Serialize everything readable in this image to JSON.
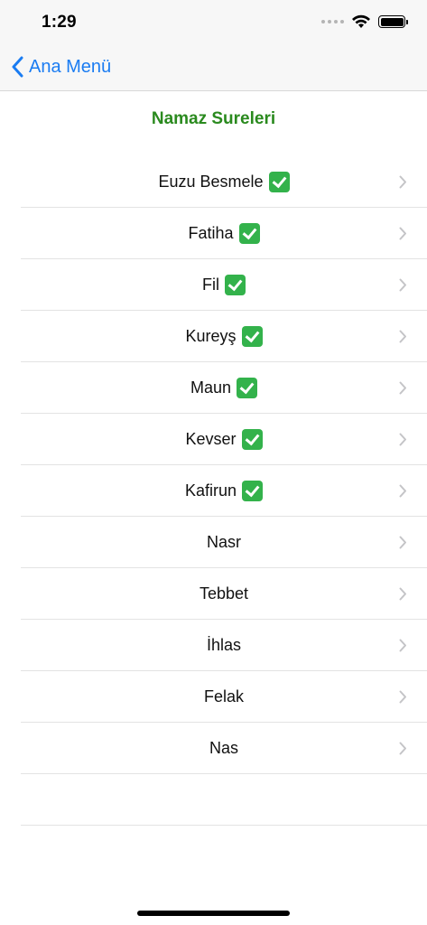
{
  "status": {
    "time": "1:29"
  },
  "nav": {
    "back_label": "Ana Menü"
  },
  "page": {
    "title": "Namaz Sureleri"
  },
  "list": {
    "items": [
      {
        "label": "Euzu Besmele",
        "checked": true
      },
      {
        "label": "Fatiha",
        "checked": true
      },
      {
        "label": "Fil",
        "checked": true
      },
      {
        "label": "Kureyş",
        "checked": true
      },
      {
        "label": "Maun",
        "checked": true
      },
      {
        "label": "Kevser",
        "checked": true
      },
      {
        "label": "Kafirun",
        "checked": true
      },
      {
        "label": "Nasr",
        "checked": false
      },
      {
        "label": "Tebbet",
        "checked": false
      },
      {
        "label": "İhlas",
        "checked": false
      },
      {
        "label": "Felak",
        "checked": false
      },
      {
        "label": "Nas",
        "checked": false
      },
      {
        "label": "",
        "checked": false
      }
    ]
  },
  "colors": {
    "accent_blue": "#1a7cf2",
    "title_green": "#2a8a1e",
    "check_green": "#33b24b"
  },
  "icons": {
    "back": "chevron-left-icon",
    "row": "chevron-right-icon",
    "checked": "check-mark-button-icon"
  }
}
